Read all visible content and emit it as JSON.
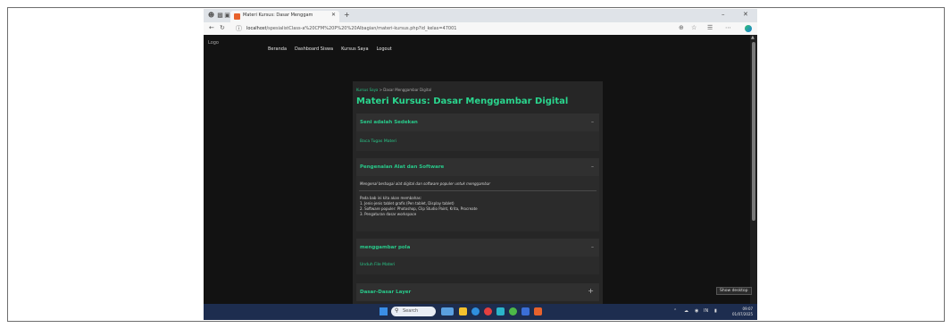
{
  "browser": {
    "tab_title": "Materi Kursus: Dasar Menggam",
    "url_host": "localhost",
    "url_rest": "/spesialistClass-a%20CFM%20P%20%20Albagian/materi-kursus.php?id_kelas=47001"
  },
  "site": {
    "logo_alt": "Logo",
    "nav": [
      "Beranda",
      "Dashboard Siswa",
      "Kursus Saya",
      "Logout"
    ]
  },
  "breadcrumb": {
    "link": "Kursus Saya",
    "separator": " > ",
    "current": "Dasar Menggambar Digital"
  },
  "page_title": "Materi Kursus: Dasar Menggambar Digital",
  "sections": [
    {
      "title": "Seni adalah Sedekan",
      "toggle": "–",
      "link": "Baca Tugas Materi"
    },
    {
      "title": "Pengenalan Alat dan Software",
      "toggle": "–",
      "intro": "Mengenal berbagai alat digital dan software populer untuk menggambar",
      "body": [
        "Pada bab ini kita akan membahas:",
        "1. Jenis-jenis tablet grafis (Pen tablet, Display tablet)",
        "2. Software populer: Photoshop, Clip Studio Paint, Krita, Procreate",
        "3. Pengaturan dasar workspace"
      ]
    },
    {
      "title": "menggambar pola",
      "toggle": "–",
      "link": "Unduh File Materi"
    },
    {
      "title": "Dasar-Dasar Layer",
      "toggle": "+"
    }
  ],
  "taskbar": {
    "search_placeholder": "Search",
    "time": "09:07",
    "date": "01/07/2025",
    "lang": "IN",
    "show_desktop": "Show desktop"
  },
  "colors": {
    "accent": "#28c98a",
    "site_bg": "#121212",
    "panel_bg": "#262626"
  }
}
